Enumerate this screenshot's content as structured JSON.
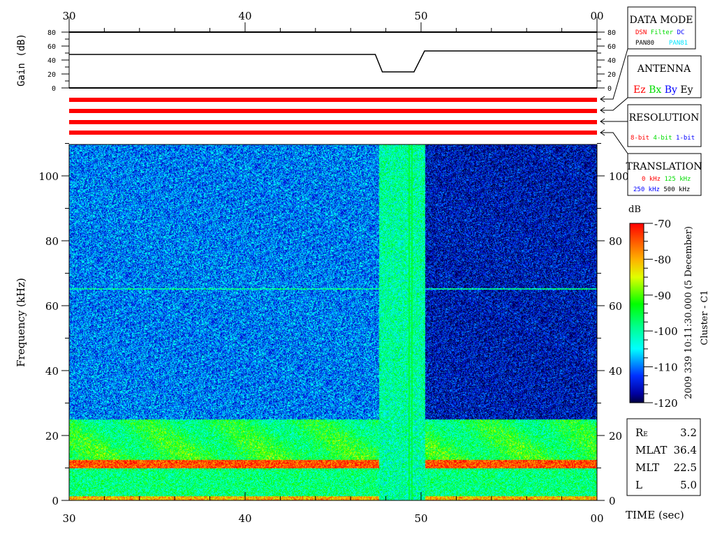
{
  "chart_data": {
    "type": "heatmap",
    "title": "Cluster - C1",
    "date_label": "2009 339 10:11:30.000 (5 December)",
    "xlabel": "TIME (sec)",
    "ylabel": "Frequency (kHz)",
    "x_tick_labels": [
      "30",
      "40",
      "50",
      "00"
    ],
    "x_ticks": [
      30,
      40,
      50,
      60
    ],
    "xlim": [
      30,
      60
    ],
    "ylim": [
      0,
      110
    ],
    "y_ticks": [
      0,
      20,
      40,
      60,
      80,
      100
    ],
    "colorbar": {
      "label": "dB",
      "range": [
        -120,
        -70
      ],
      "ticks": [
        -70,
        -80,
        -90,
        -100,
        -110,
        -120
      ]
    },
    "regions": [
      {
        "t_start": 30,
        "t_end": 47.6,
        "background_db": -110
      },
      {
        "t_start": 47.6,
        "t_end": 50.2,
        "background_db": -100
      },
      {
        "t_start": 50.2,
        "t_end": 60,
        "background_db": -116
      }
    ],
    "features": [
      {
        "name": "intense band",
        "freq_khz": 12,
        "level_db": -75
      },
      {
        "name": "low-frequency emission",
        "freq_range_khz": [
          0,
          25
        ],
        "level_db": -92
      },
      {
        "name": "narrowband line",
        "freq_khz": 65,
        "level_db": -100
      }
    ],
    "gain": {
      "ylabel": "Gain (dB)",
      "ylim": [
        0,
        80
      ],
      "y_ticks": [
        0,
        20,
        40,
        60,
        80
      ],
      "x": [
        30,
        47.4,
        47.8,
        49.6,
        50.2,
        60
      ],
      "values": [
        48,
        48,
        23,
        23,
        53,
        53
      ]
    }
  },
  "legend": {
    "data_mode": {
      "title": "DATA MODE",
      "items": [
        {
          "label": "DSN",
          "color": "#ff0000"
        },
        {
          "label": "Filter",
          "color": "#00dd00"
        },
        {
          "label": "DC",
          "color": "#0000ff"
        },
        {
          "label": "PAN80",
          "color": "#000000"
        },
        {
          "label": "PAN81",
          "color": "#00e5ff"
        }
      ]
    },
    "antenna": {
      "title": "ANTENNA",
      "items": [
        {
          "label": "Ez",
          "color": "#ff0000"
        },
        {
          "label": "Bx",
          "color": "#00dd00"
        },
        {
          "label": "By",
          "color": "#0000ff"
        },
        {
          "label": "Ey",
          "color": "#000000"
        }
      ]
    },
    "resolution": {
      "title": "RESOLUTION",
      "items": [
        {
          "label": "8-bit",
          "color": "#ff0000"
        },
        {
          "label": "4-bit",
          "color": "#00dd00"
        },
        {
          "label": "1-bit",
          "color": "#0000ff"
        }
      ]
    },
    "translation": {
      "title": "TRANSLATION",
      "items": [
        {
          "label": "0 kHz",
          "color": "#ff0000"
        },
        {
          "label": "125 kHz",
          "color": "#00dd00"
        },
        {
          "label": "250 kHz",
          "color": "#0000ff"
        },
        {
          "label": "500 kHz",
          "color": "#000000"
        }
      ]
    }
  },
  "status_bars_color": "#ff0000",
  "orbit": [
    {
      "label": "R",
      "sub": "E",
      "value": "3.2"
    },
    {
      "label": "MLAT",
      "sub": "",
      "value": "36.4"
    },
    {
      "label": "MLT",
      "sub": "",
      "value": "22.5"
    },
    {
      "label": "L",
      "sub": "",
      "value": "5.0"
    }
  ]
}
